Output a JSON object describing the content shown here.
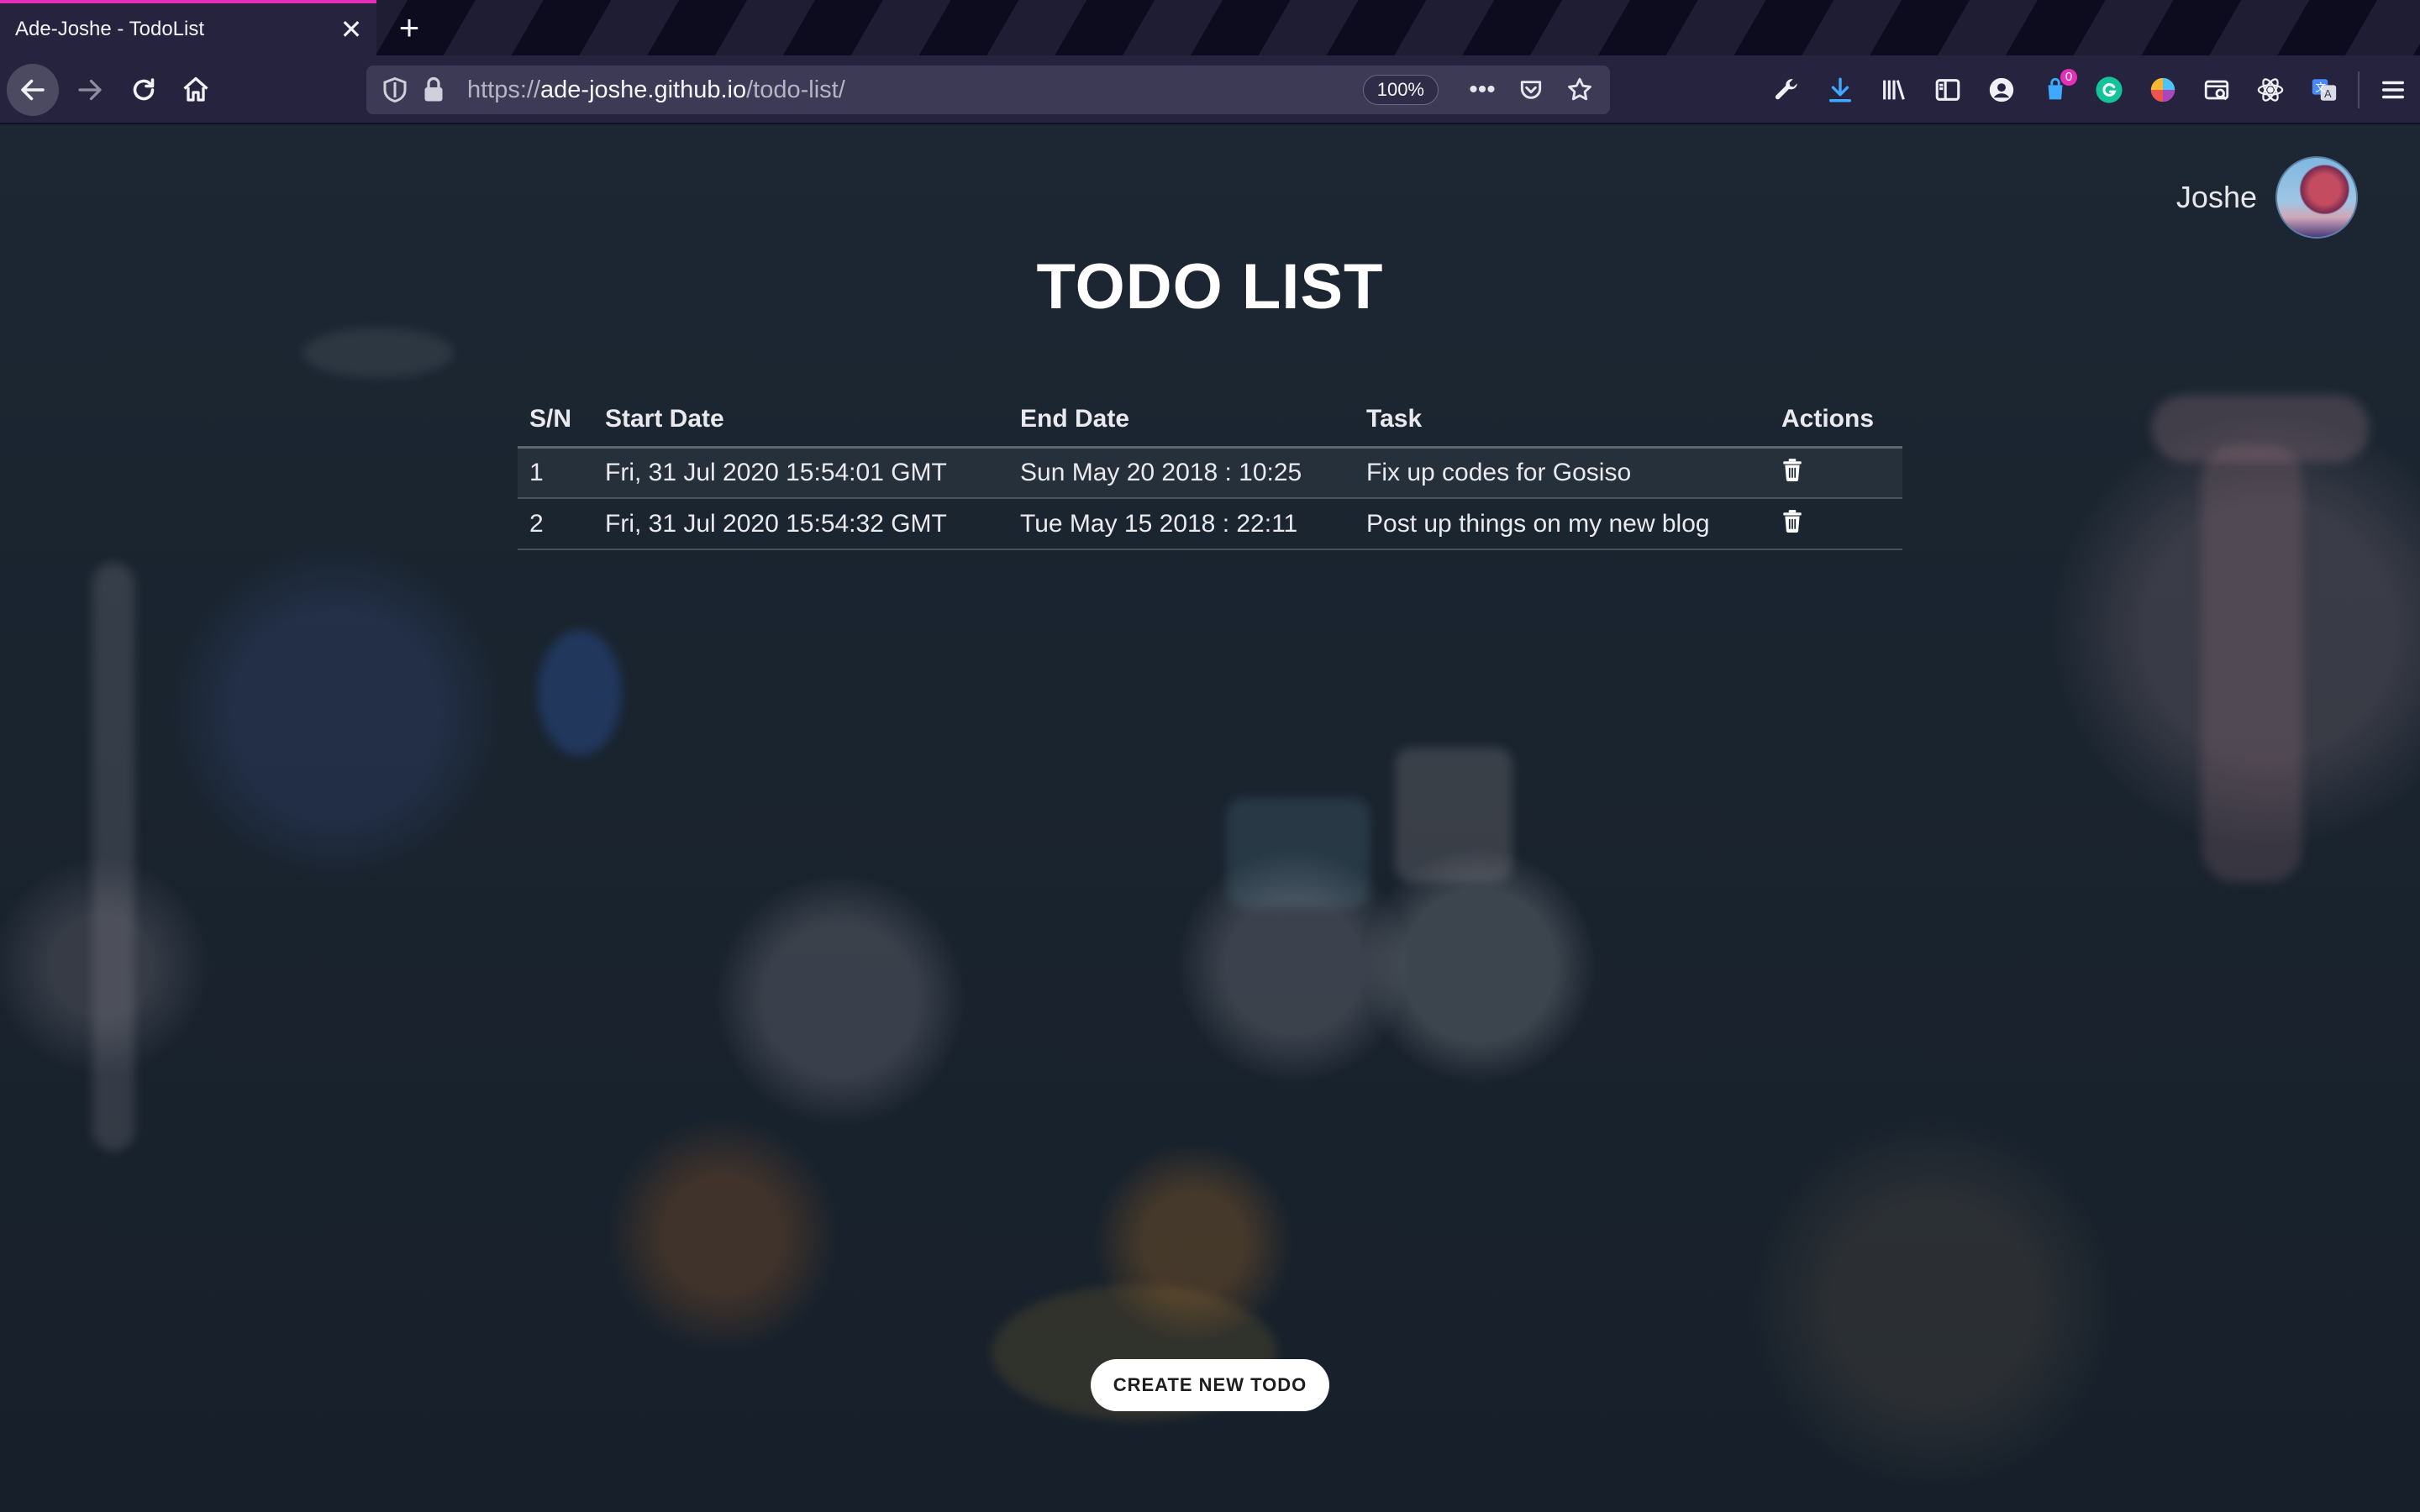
{
  "browser": {
    "tab": {
      "title": "Ade-Joshe - TodoList",
      "close_label": "✕"
    },
    "new_tab_label": "+",
    "url": {
      "scheme": "https://",
      "host": "ade-joshe.github.io",
      "path": "/todo-list/"
    },
    "zoom": "100%",
    "overflow_label": "•••",
    "toolbar": {
      "notification_badge": "0",
      "icons": [
        "wrench-icon",
        "download-icon",
        "library-icon",
        "sidebar-icon",
        "account-icon",
        "extension-notifications-icon",
        "grammarly-icon",
        "color-picker-icon",
        "screenshot-icon",
        "react-devtools-icon",
        "translate-icon",
        "menu-icon"
      ]
    },
    "colors": {
      "accent": "#e62fb7",
      "chrome": "#25233d"
    }
  },
  "user": {
    "name": "Joshe"
  },
  "page": {
    "title": "TODO LIST",
    "table": {
      "headers": [
        "S/N",
        "Start Date",
        "End Date",
        "Task",
        "Actions"
      ],
      "rows": [
        {
          "sn": "1",
          "start": "Fri, 31 Jul 2020 15:54:01 GMT",
          "end": "Sun May 20 2018 : 10:25",
          "task": "Fix up codes for Gosiso"
        },
        {
          "sn": "2",
          "start": "Fri, 31 Jul 2020 15:54:32 GMT",
          "end": "Tue May 15 2018 : 22:11",
          "task": "Post up things on my new blog"
        }
      ]
    },
    "create_button": "CREATE NEW TODO"
  }
}
